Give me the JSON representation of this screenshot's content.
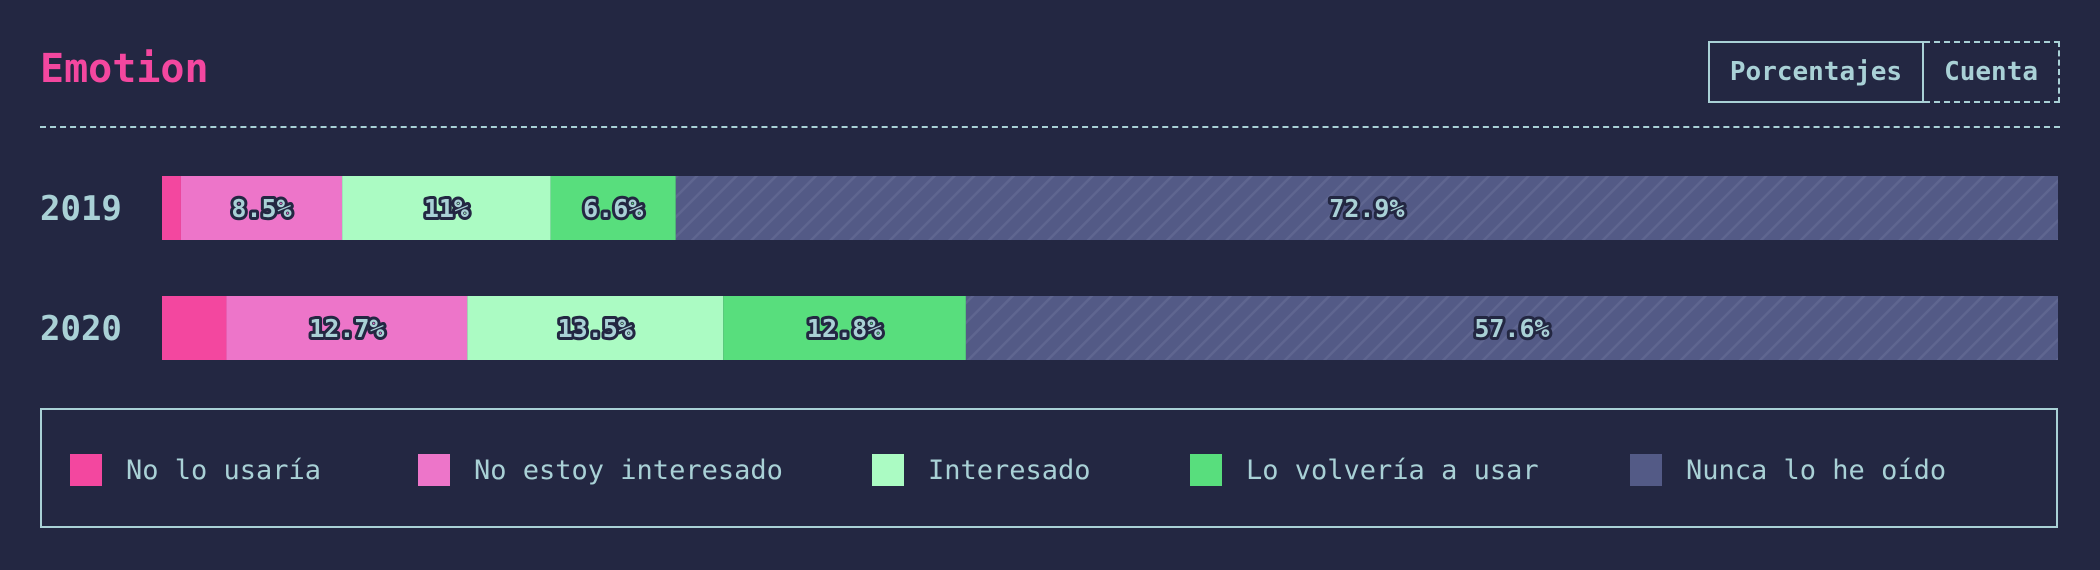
{
  "header": {
    "title": "Emotion",
    "toggle": [
      "Porcentajes",
      "Cuenta"
    ]
  },
  "colors": {
    "background": "#232742",
    "text": "#a9d1d6",
    "title": "#f3479f"
  },
  "chart_data": {
    "type": "bar",
    "orientation": "horizontal",
    "stacked": true,
    "unit": "percent",
    "title": "Emotion",
    "categories": [
      "2019",
      "2020"
    ],
    "series": [
      {
        "name": "No lo usaría",
        "color": "#f3479f",
        "values": [
          1.0,
          3.4
        ],
        "labels": [
          "",
          ""
        ]
      },
      {
        "name": "No estoy interesado",
        "color": "#ed75c9",
        "values": [
          8.5,
          12.7
        ],
        "labels": [
          "8.5%",
          "12.7%"
        ]
      },
      {
        "name": "Interesado",
        "color": "#abfbc3",
        "values": [
          11.0,
          13.5
        ],
        "labels": [
          "11%",
          "13.5%"
        ]
      },
      {
        "name": "Lo volvería a usar",
        "color": "#58de7d",
        "values": [
          6.6,
          12.8
        ],
        "labels": [
          "6.6%",
          "12.8%"
        ]
      },
      {
        "name": "Nunca lo he oído",
        "color": "#535a86",
        "values": [
          72.9,
          57.6
        ],
        "labels": [
          "72.9%",
          "57.6%"
        ]
      }
    ],
    "legend_position": "bottom",
    "grid": false
  }
}
